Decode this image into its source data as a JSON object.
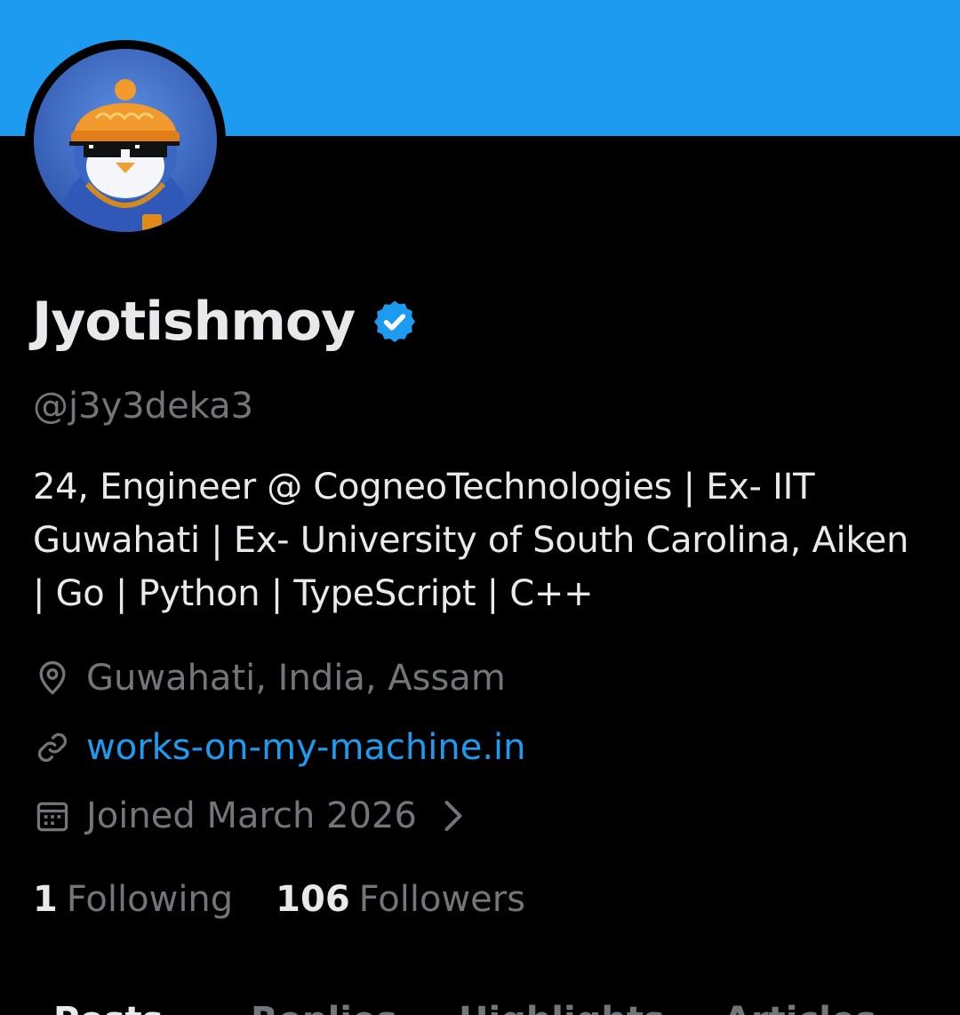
{
  "profile": {
    "display_name": "Jyotishmoy",
    "handle": "@j3y3deka3",
    "bio": "24, Engineer @ CogneoTechnologies | Ex- IIT Guwahati | Ex- University of South Carolina, Aiken | Go | Python | TypeScript | C++",
    "location": "Guwahati, India, Assam",
    "website": "works-on-my-machine.in",
    "joined": "Joined March 2026",
    "following_count": "1",
    "following_label": "Following",
    "followers_count": "106",
    "followers_label": "Followers"
  },
  "icons": {
    "verified": "verified-badge-icon",
    "location": "location-pin-icon",
    "link": "link-icon",
    "calendar": "calendar-icon",
    "chevron": "chevron-right-icon"
  },
  "tabs": [
    {
      "label": "Posts",
      "active": true
    },
    {
      "label": "Replies",
      "active": false
    },
    {
      "label": "Highlights",
      "active": false
    },
    {
      "label": "Articles",
      "active": false
    }
  ],
  "colors": {
    "banner": "#1d9bf0",
    "background": "#000000",
    "primary_text": "#e7e9ea",
    "secondary_text": "#71767b",
    "accent": "#1d9bf0"
  }
}
